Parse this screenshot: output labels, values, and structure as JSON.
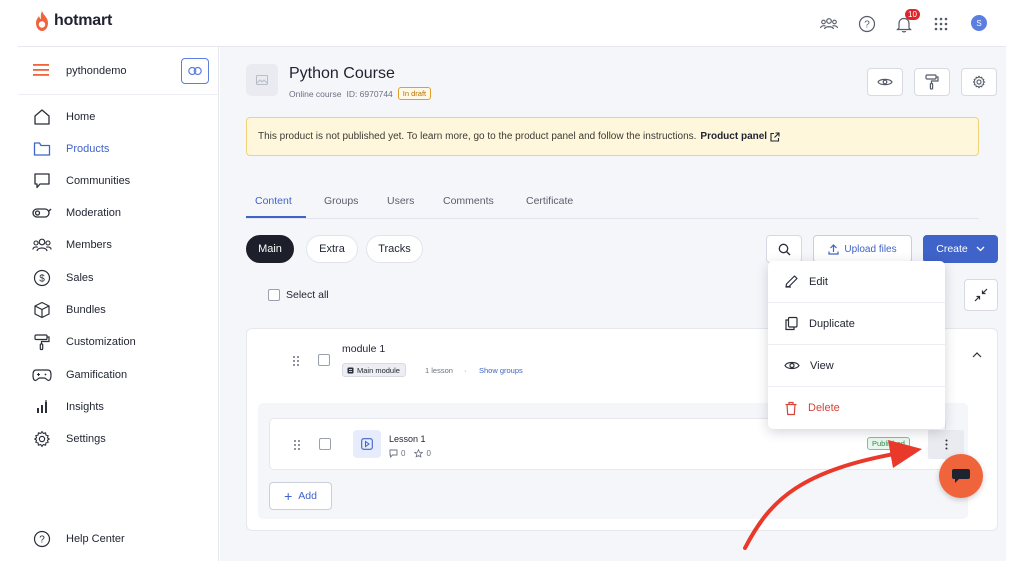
{
  "brand": {
    "name": "hotmart",
    "accent": "#3f63c8",
    "logo_color": "#f0643c"
  },
  "topbar": {
    "notifications_count": "10",
    "avatar_initial": "S"
  },
  "sidebar": {
    "account": "pythondemo",
    "items": [
      {
        "label": "Home",
        "icon": "home-icon"
      },
      {
        "label": "Products",
        "icon": "folder-icon"
      },
      {
        "label": "Communities",
        "icon": "chat-bubble-icon"
      },
      {
        "label": "Moderation",
        "icon": "moderation-icon"
      },
      {
        "label": "Members",
        "icon": "members-icon"
      },
      {
        "label": "Sales",
        "icon": "dollar-icon"
      },
      {
        "label": "Bundles",
        "icon": "box-icon"
      },
      {
        "label": "Customization",
        "icon": "paint-roller-icon"
      },
      {
        "label": "Gamification",
        "icon": "gamepad-icon"
      },
      {
        "label": "Insights",
        "icon": "bar-chart-icon"
      },
      {
        "label": "Settings",
        "icon": "gear-icon"
      }
    ],
    "help": "Help Center"
  },
  "product": {
    "title": "Python Course",
    "type": "Online course",
    "id_label": "ID: 6970744",
    "status": "In draft"
  },
  "banner": {
    "text": "This product is not published yet. To learn more, go to the product panel and follow the instructions.",
    "link": "Product panel"
  },
  "tabs": [
    "Content",
    "Groups",
    "Users",
    "Comments",
    "Certificate"
  ],
  "filters": [
    "Main",
    "Extra",
    "Tracks"
  ],
  "toolbar": {
    "upload": "Upload files",
    "create": "Create",
    "select_all": "Select all"
  },
  "module": {
    "title": "module 1",
    "badge": "Main module",
    "lessons": "1 lesson",
    "separator": "·",
    "show_groups": "Show groups"
  },
  "lesson": {
    "title": "Lesson 1",
    "comments": "0",
    "ratings": "0",
    "status": "Published"
  },
  "add_label": "Add",
  "menu": [
    "Edit",
    "Duplicate",
    "View",
    "Delete"
  ]
}
